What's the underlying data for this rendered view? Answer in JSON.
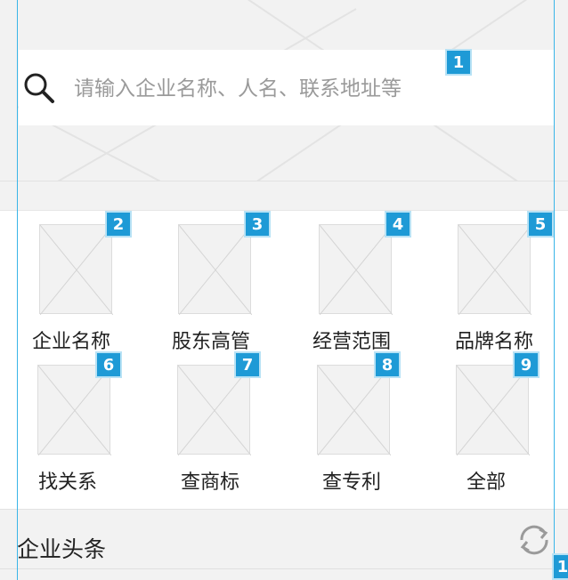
{
  "search": {
    "placeholder": "请输入企业名称、人名、联系地址等",
    "badge": "1"
  },
  "categories": [
    {
      "label": "企业名称",
      "badge": "2"
    },
    {
      "label": "股东高管",
      "badge": "3"
    },
    {
      "label": "经营范围",
      "badge": "4"
    },
    {
      "label": "品牌名称",
      "badge": "5"
    },
    {
      "label": "找关系",
      "badge": "6"
    },
    {
      "label": "查商标",
      "badge": "7"
    },
    {
      "label": "查专利",
      "badge": "8"
    },
    {
      "label": "全部",
      "badge": "9"
    }
  ],
  "news": {
    "title": "企业头条",
    "badge": "1"
  },
  "colors": {
    "badge": "#1e9ad6",
    "placeholder_bg": "#f2f2f2",
    "guide": "#39b5e8"
  }
}
